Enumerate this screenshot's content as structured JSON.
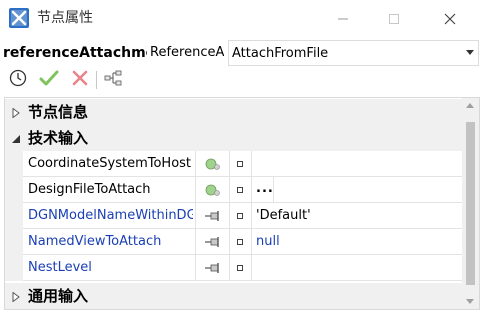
{
  "window": {
    "title": "节点属性"
  },
  "node": {
    "name": "referenceAttachme",
    "type": "ReferenceA",
    "selected": "AttachFromFile"
  },
  "toolbar": {
    "icons": [
      "clock-icon",
      "check-icon",
      "cross-icon",
      "hierarchy-icon"
    ]
  },
  "categories": {
    "node_info": "节点信息",
    "tech_input": "技术输入",
    "general_input": "通用输入"
  },
  "properties": [
    {
      "name": "CoordinateSystemToHost",
      "name_color": "#000000",
      "icon": "globe-icon",
      "value": ""
    },
    {
      "name": "DesignFileToAttach",
      "name_color": "#000000",
      "icon": "globe-icon",
      "value": ""
    },
    {
      "name": "DGNModelNameWithinDGN",
      "name_color": "#1a3fb5",
      "icon": "pin-icon",
      "value": "'Default'"
    },
    {
      "name": "NamedViewToAttach",
      "name_color": "#1a3fb5",
      "icon": "pin-icon",
      "value": "null"
    },
    {
      "name": "NestLevel",
      "name_color": "#1a3fb5",
      "icon": "pin-icon",
      "value": ""
    }
  ],
  "design_file_button": "...",
  "colors": {
    "link_blue": "#1a3fb5",
    "check_green": "#7ec35b",
    "cross_red": "#e8868a"
  }
}
